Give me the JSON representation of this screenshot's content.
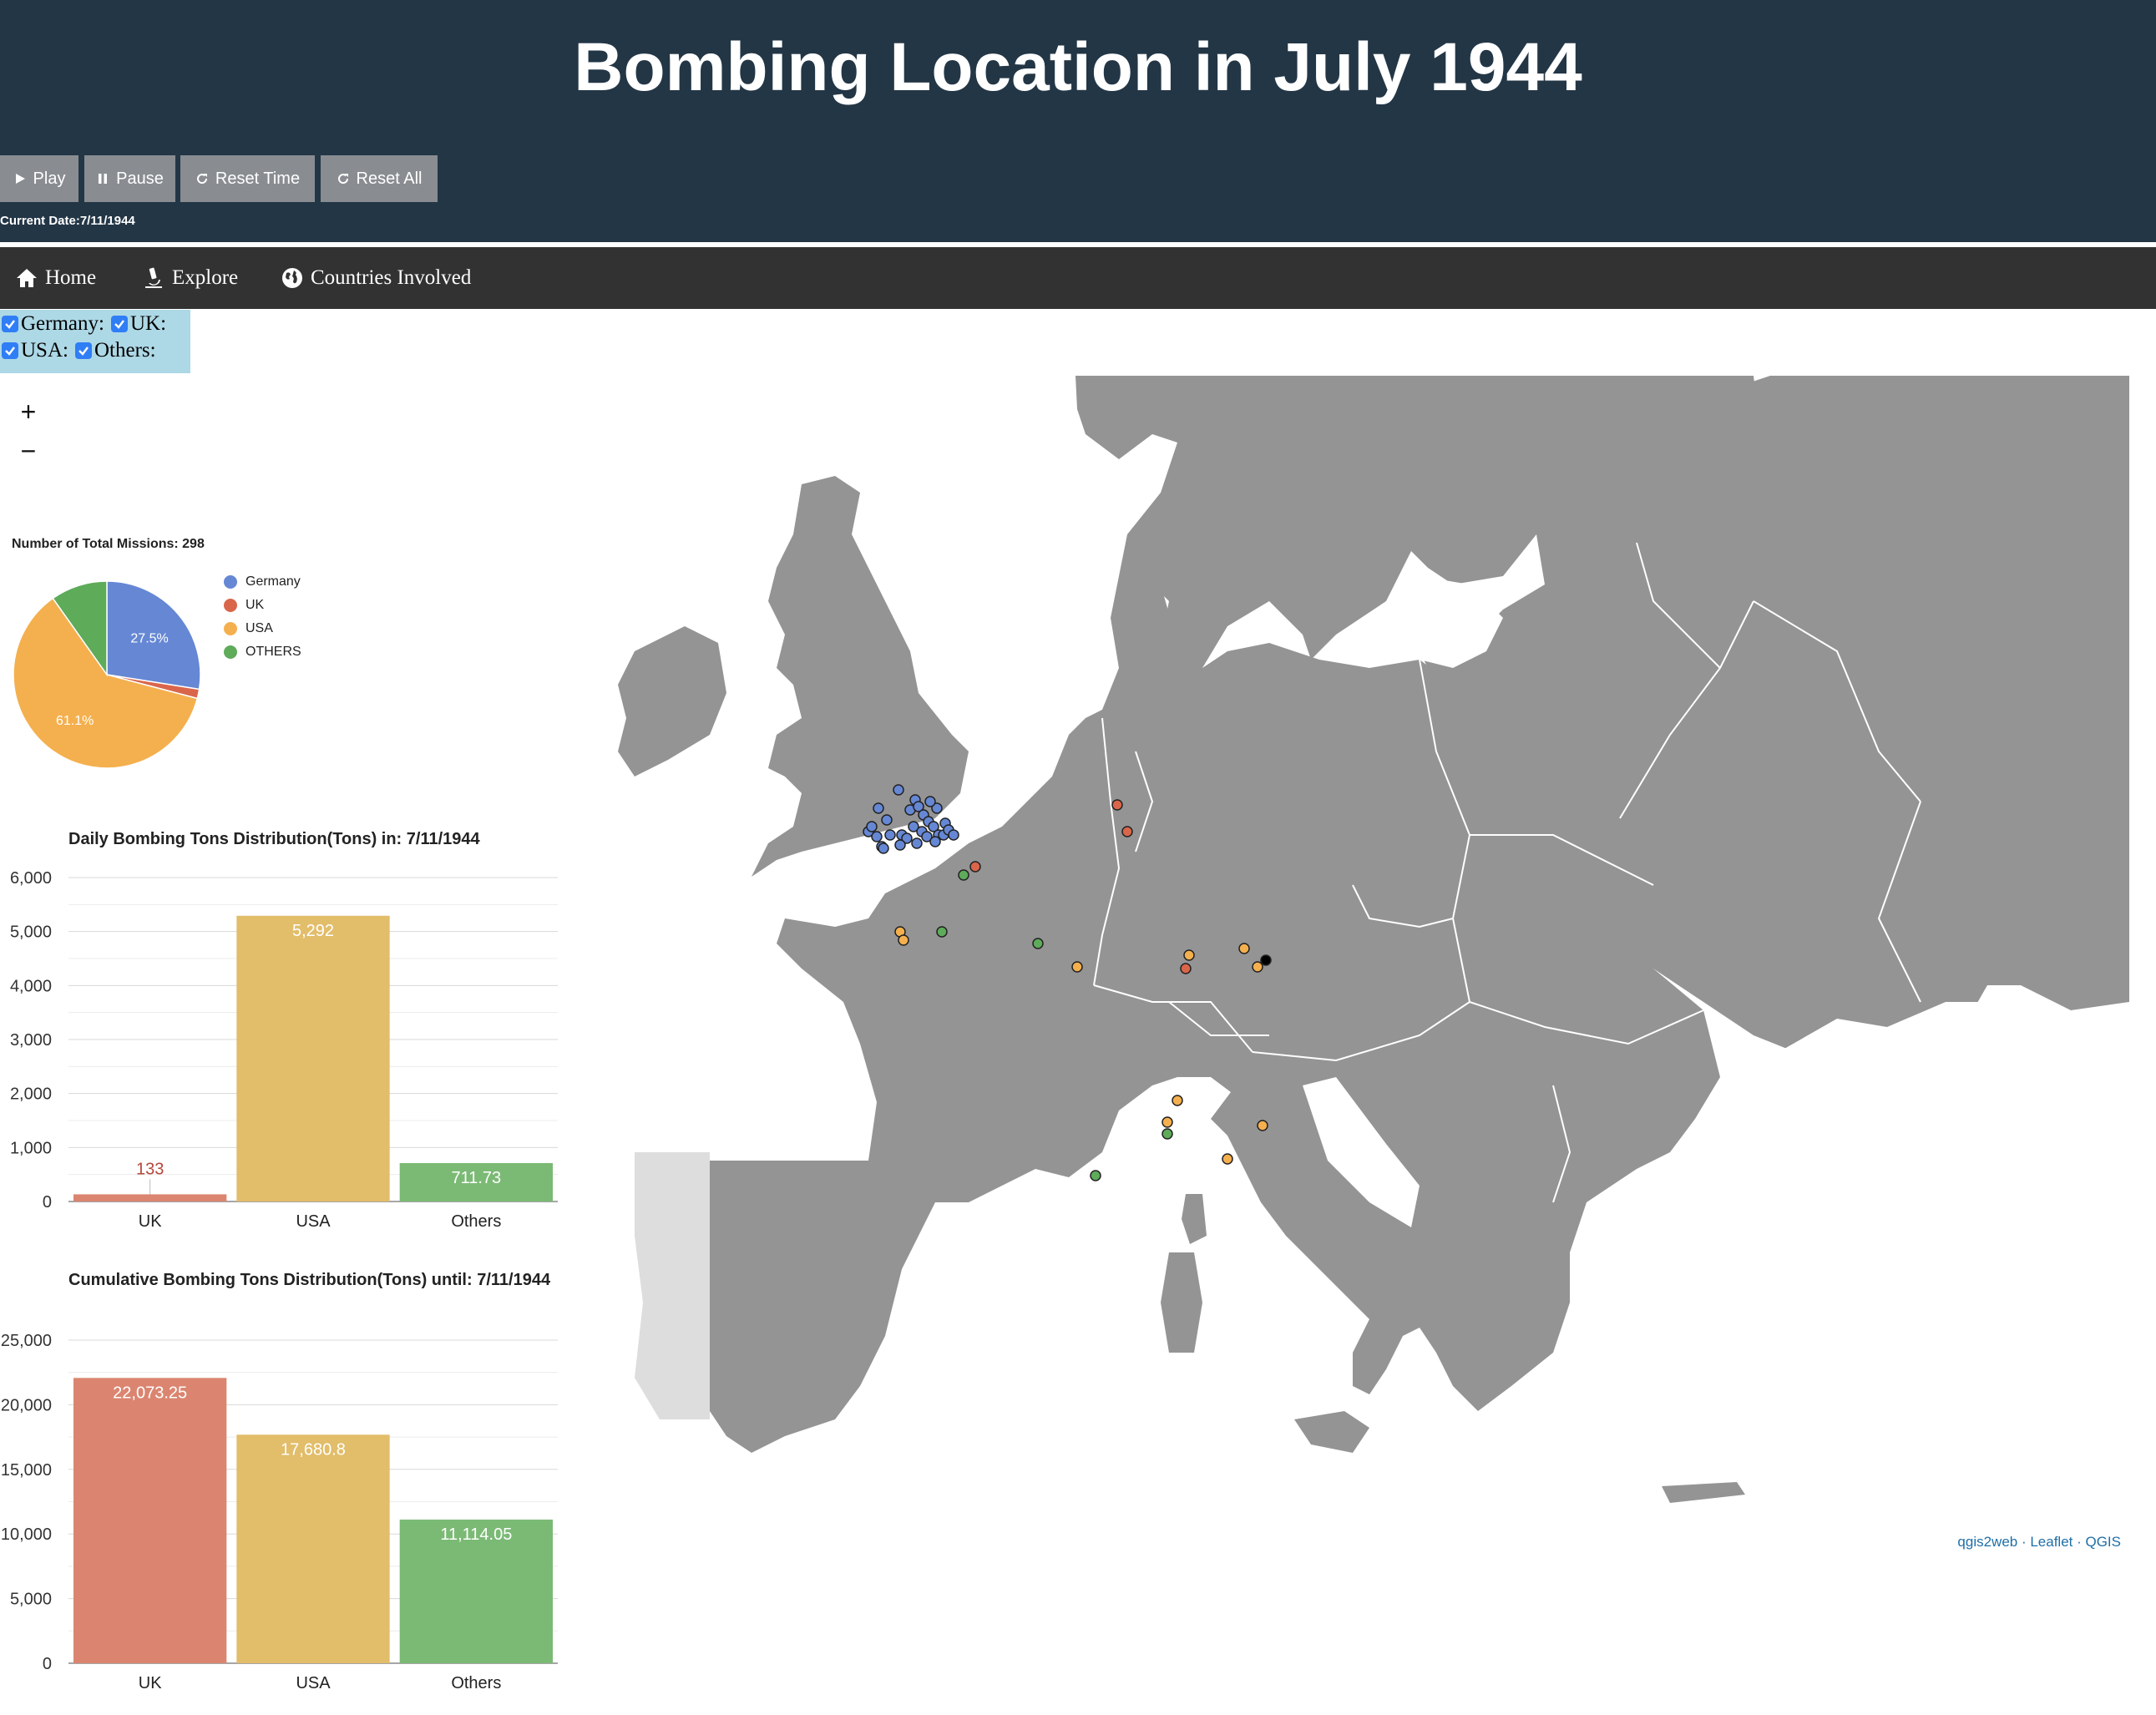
{
  "header": {
    "title": "Bombing Location in July 1944",
    "current_date_label": "Current Date:7/11/1944"
  },
  "controls": [
    {
      "label": "Play",
      "icon": "play-icon"
    },
    {
      "label": "Pause",
      "icon": "pause-icon"
    },
    {
      "label": "Reset Time",
      "icon": "refresh-icon"
    },
    {
      "label": "Reset All",
      "icon": "refresh-icon"
    }
  ],
  "nav": [
    {
      "label": "Home",
      "icon": "home-icon"
    },
    {
      "label": "Explore",
      "icon": "microscope-icon"
    },
    {
      "label": "Countries Involved",
      "icon": "globe-icon"
    }
  ],
  "filters": [
    {
      "label": "Germany:",
      "checked": true
    },
    {
      "label": "UK:",
      "checked": true
    },
    {
      "label": "USA:",
      "checked": true
    },
    {
      "label": "Others:",
      "checked": true
    }
  ],
  "zoom": {
    "in": "+",
    "out": "−"
  },
  "attribution": "qgis2web · Leaflet · QGIS",
  "colors": {
    "germany": "#6587d4",
    "uk": "#d9664b",
    "usa": "#f4b04e",
    "others": "#5eab5a",
    "bar_uk": "#db8570",
    "bar_usa": "#e2bd6a",
    "bar_others": "#7bba75",
    "header_bg": "#233646",
    "nav_bg": "#323232",
    "map_land": "#949494"
  },
  "chart_data": [
    {
      "type": "pie",
      "title": "Number of Total Missions: 298",
      "categories": [
        "Germany",
        "UK",
        "USA",
        "OTHERS"
      ],
      "values": [
        27.5,
        1.6,
        61.1,
        9.8
      ],
      "value_labels": [
        "27.5%",
        "",
        "61.1%",
        ""
      ],
      "legend_position": "right"
    },
    {
      "type": "bar",
      "title": "Daily Bombing Tons Distribution(Tons) in: 7/11/1944",
      "categories": [
        "UK",
        "USA",
        "Others"
      ],
      "values": [
        133,
        5292,
        711.73
      ],
      "value_labels": [
        "133",
        "5,292",
        "711.73"
      ],
      "ylim": [
        0,
        6000
      ],
      "yticks": [
        "0",
        "1,000",
        "2,000",
        "3,000",
        "4,000",
        "5,000",
        "6,000"
      ],
      "grid": true
    },
    {
      "type": "bar",
      "title": "Cumulative Bombing Tons Distribution(Tons) until: 7/11/1944",
      "categories": [
        "UK",
        "USA",
        "Others"
      ],
      "values": [
        22073.25,
        17680.8,
        11114.05
      ],
      "value_labels": [
        "22,073.25",
        "17,680.8",
        "11,114.05"
      ],
      "ylim": [
        0,
        25000
      ],
      "yticks": [
        "0",
        "5,000",
        "10,000",
        "15,000",
        "20,000",
        "25,000"
      ],
      "grid": true
    }
  ]
}
